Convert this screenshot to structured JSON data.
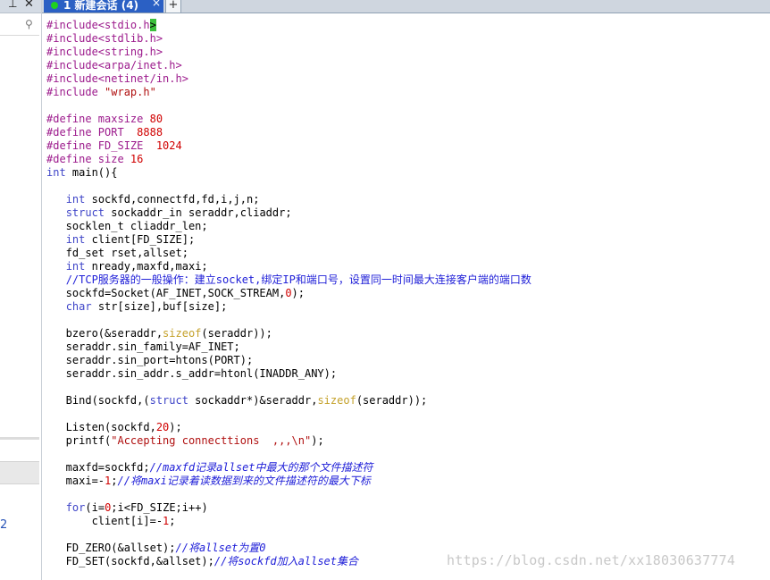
{
  "left_pane": {
    "pin_icon": "pin-icon",
    "close_icon": "close-icon",
    "search_icon": "search-icon",
    "edge_glyph": "2"
  },
  "tabs": {
    "active_label": "1 新建会话 (4)",
    "close_glyph": "×",
    "new_tab_glyph": "+"
  },
  "code_lines": [
    [
      [
        "pp",
        "#include<stdio.h"
      ],
      [
        "cursor",
        ">"
      ]
    ],
    [
      [
        "pp",
        "#include<stdlib.h>"
      ]
    ],
    [
      [
        "pp",
        "#include<string.h>"
      ]
    ],
    [
      [
        "pp",
        "#include<arpa/inet.h>"
      ]
    ],
    [
      [
        "pp",
        "#include<netinet/in.h>"
      ]
    ],
    [
      [
        "pp",
        "#include "
      ],
      [
        "str",
        "\"wrap.h\""
      ]
    ],
    [],
    [
      [
        "pp",
        "#define maxsize "
      ],
      [
        "num",
        "80"
      ]
    ],
    [
      [
        "pp",
        "#define PORT  "
      ],
      [
        "num",
        "8888"
      ]
    ],
    [
      [
        "pp",
        "#define FD_SIZE  "
      ],
      [
        "num",
        "1024"
      ]
    ],
    [
      [
        "pp",
        "#define size "
      ],
      [
        "num",
        "16"
      ]
    ],
    [
      [
        "kw",
        "int"
      ],
      [
        "n",
        " main(){"
      ]
    ],
    [],
    [
      [
        "n",
        "   "
      ],
      [
        "kw",
        "int"
      ],
      [
        "n",
        " sockfd,connectfd,fd,i,j,n;"
      ]
    ],
    [
      [
        "n",
        "   "
      ],
      [
        "kw",
        "struct"
      ],
      [
        "n",
        " sockaddr_in seraddr,cliaddr;"
      ]
    ],
    [
      [
        "n",
        "   socklen_t cliaddr_len;"
      ]
    ],
    [
      [
        "n",
        "   "
      ],
      [
        "kw",
        "int"
      ],
      [
        "n",
        " client[FD_SIZE];"
      ]
    ],
    [
      [
        "n",
        "   fd_set rset,allset;"
      ]
    ],
    [
      [
        "n",
        "   "
      ],
      [
        "kw",
        "int"
      ],
      [
        "n",
        " nready,maxfd,maxi;"
      ]
    ],
    [
      [
        "n",
        "   "
      ],
      [
        "cmz",
        "//TCP服务器的一般操作：建立socket,绑定IP和端口号，设置同一时间最大连接客户端的端口数"
      ]
    ],
    [
      [
        "n",
        "   sockfd=Socket(AF_INET,SOCK_STREAM,"
      ],
      [
        "num",
        "0"
      ],
      [
        "n",
        ");"
      ]
    ],
    [
      [
        "n",
        "   "
      ],
      [
        "kw",
        "char"
      ],
      [
        "n",
        " str[size],buf[size];"
      ]
    ],
    [],
    [
      [
        "n",
        "   bzero(&seraddr,"
      ],
      [
        "kw2",
        "sizeof"
      ],
      [
        "n",
        "(seraddr));"
      ]
    ],
    [
      [
        "n",
        "   seraddr.sin_family=AF_INET;"
      ]
    ],
    [
      [
        "n",
        "   seraddr.sin_port=htons(PORT);"
      ]
    ],
    [
      [
        "n",
        "   seraddr.sin_addr.s_addr=htonl(INADDR_ANY);"
      ]
    ],
    [],
    [
      [
        "n",
        "   Bind(sockfd,("
      ],
      [
        "kw",
        "struct"
      ],
      [
        "n",
        " sockaddr*)&seraddr,"
      ],
      [
        "kw2",
        "sizeof"
      ],
      [
        "n",
        "(seraddr));"
      ]
    ],
    [],
    [
      [
        "n",
        "   Listen(sockfd,"
      ],
      [
        "num",
        "20"
      ],
      [
        "n",
        ");"
      ]
    ],
    [
      [
        "n",
        "   printf("
      ],
      [
        "str",
        "\"Accepting connecttions  ,,,\\n\""
      ],
      [
        "n",
        ");"
      ]
    ],
    [],
    [
      [
        "n",
        "   maxfd=sockfd;"
      ],
      [
        "cm",
        "//maxfd记录allset中最大的那个文件描述符"
      ]
    ],
    [
      [
        "n",
        "   maxi=-"
      ],
      [
        "num",
        "1"
      ],
      [
        "n",
        ";"
      ],
      [
        "cm",
        "//将maxi记录着读数据到来的文件描述符的最大下标"
      ]
    ],
    [],
    [
      [
        "n",
        "   "
      ],
      [
        "kw",
        "for"
      ],
      [
        "n",
        "(i="
      ],
      [
        "num",
        "0"
      ],
      [
        "n",
        ";i<FD_SIZE;i++)"
      ]
    ],
    [
      [
        "n",
        "       client[i]=-"
      ],
      [
        "num",
        "1"
      ],
      [
        "n",
        ";"
      ]
    ],
    [],
    [
      [
        "n",
        "   FD_ZERO(&allset);"
      ],
      [
        "cm",
        "//将allset为置0"
      ]
    ],
    [
      [
        "n",
        "   FD_SET(sockfd,&allset);"
      ],
      [
        "cm",
        "//将sockfd加入allset集合"
      ]
    ]
  ],
  "watermark": "https://blog.csdn.net/xx18030637774",
  "colors": {
    "tab_active": "#2b60c4",
    "status_dot": "#1fd11f",
    "preprocessor": "#9c1a8c",
    "keyword": "#3f45c8",
    "number": "#d00000",
    "comment": "#2020d8"
  }
}
